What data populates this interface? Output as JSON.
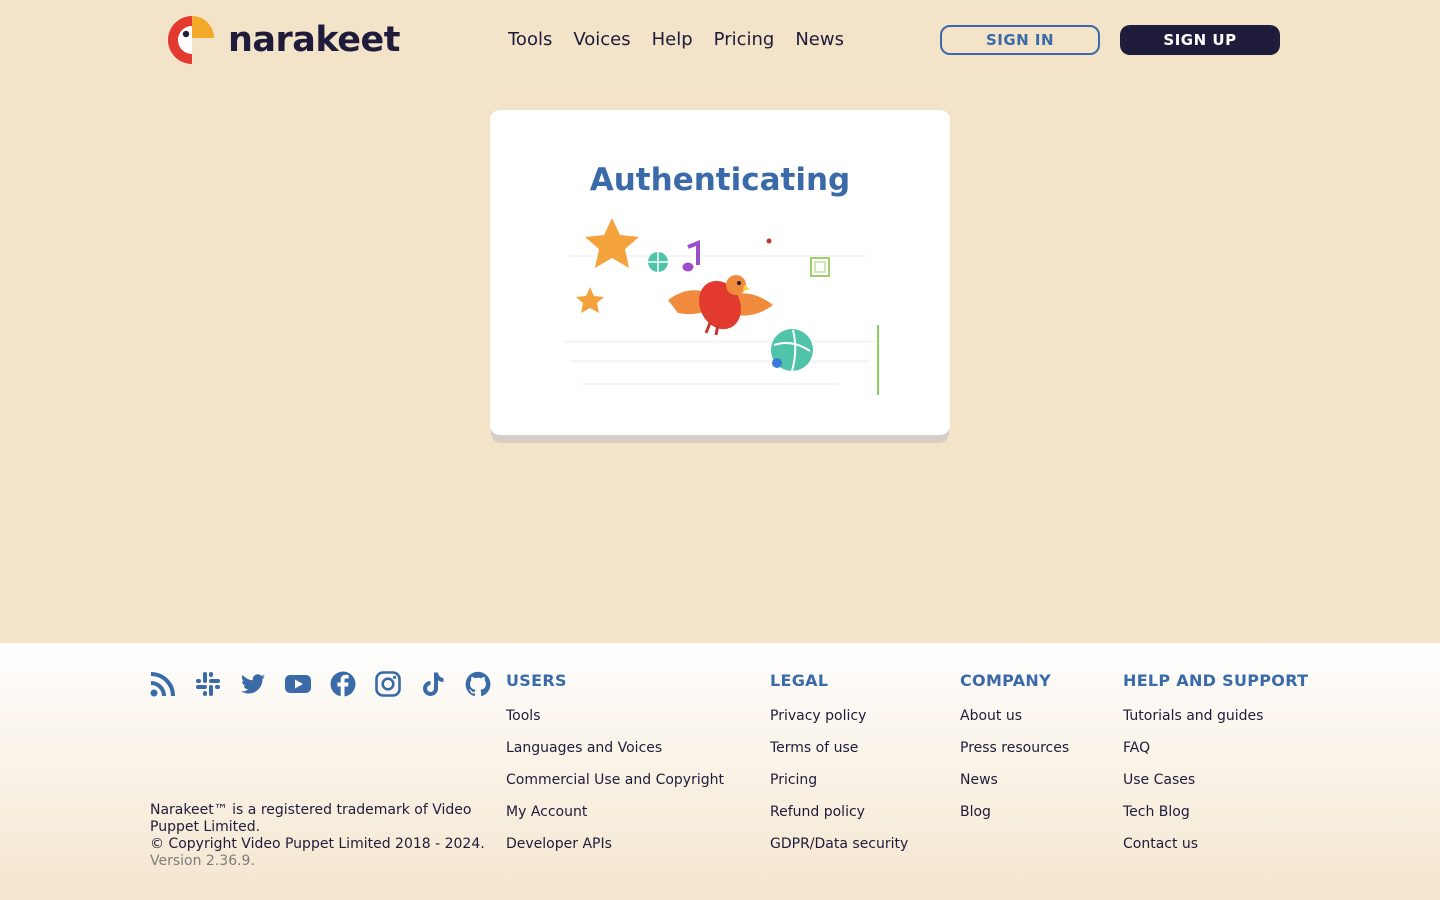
{
  "brand": {
    "name": "narakeet",
    "colors": {
      "navy": "#1f1b3a",
      "blue": "#3a6aa8",
      "red": "#e23a2e",
      "orange": "#f4a92a",
      "background": "#f2e3c9"
    }
  },
  "nav": {
    "items": [
      "Tools",
      "Voices",
      "Help",
      "Pricing",
      "News"
    ]
  },
  "auth": {
    "sign_in": "SIGN IN",
    "sign_up": "SIGN UP"
  },
  "card": {
    "title": "Authenticating"
  },
  "footer": {
    "social_icons": [
      "rss-icon",
      "slack-icon",
      "twitter-icon",
      "youtube-icon",
      "facebook-icon",
      "instagram-icon",
      "tiktok-icon",
      "github-icon"
    ],
    "trademark": "Narakeet™ is a registered trademark of Video Puppet Limited.",
    "copyright": "© Copyright Video Puppet Limited 2018 - 2024.",
    "version": "Version 2.36.9.",
    "columns": [
      {
        "title": "USERS",
        "links": [
          "Tools",
          "Languages and Voices",
          "Commercial Use and Copyright",
          "My Account",
          "Developer APIs"
        ]
      },
      {
        "title": "LEGAL",
        "links": [
          "Privacy policy",
          "Terms of use",
          "Pricing",
          "Refund policy",
          "GDPR/Data security"
        ]
      },
      {
        "title": "COMPANY",
        "links": [
          "About us",
          "Press resources",
          "News",
          "Blog"
        ]
      },
      {
        "title": "HELP AND SUPPORT",
        "links": [
          "Tutorials and guides",
          "FAQ",
          "Use Cases",
          "Tech Blog",
          "Contact us"
        ]
      }
    ]
  }
}
